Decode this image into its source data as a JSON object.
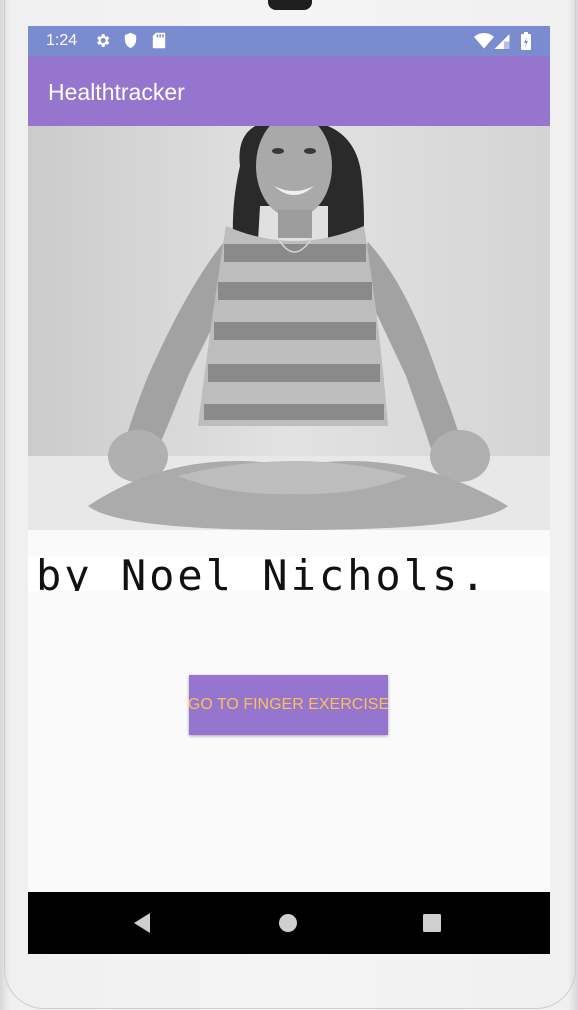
{
  "status_bar": {
    "time": "1:24",
    "icons": [
      "settings-icon",
      "shield-icon",
      "sd-card-icon",
      "wifi-icon",
      "cell-signal-icon",
      "battery-icon"
    ],
    "background": "#7a8ccf"
  },
  "app_bar": {
    "title": "Healthtracker",
    "background": "#9575cd"
  },
  "carousel": {
    "image": "photo of smiling woman in striped dress sitting cross-legged (grayscale)",
    "page_count": 4,
    "active_page": 1
  },
  "caption": {
    "text": "by Noel Nichols."
  },
  "main": {
    "button_label": "GO TO FINGER EXERCISE",
    "button_text_color": "#f6c25a"
  },
  "nav_bar": {
    "buttons": [
      "back-icon",
      "home-icon",
      "recents-icon"
    ]
  }
}
